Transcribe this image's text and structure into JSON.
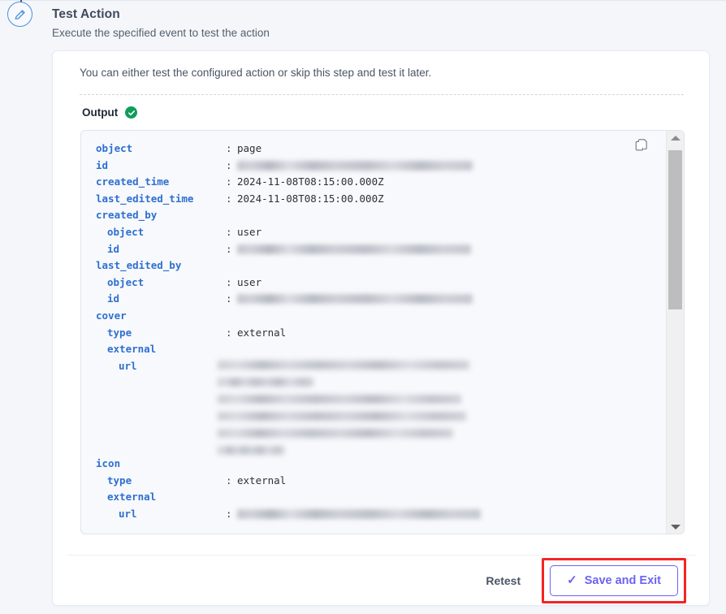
{
  "step": {
    "icon": "pencil-circle-icon",
    "accent_color": "#4a90e2"
  },
  "header": {
    "title": "Test Action",
    "subtitle": "Execute the specified event to test the action"
  },
  "card": {
    "intro": "You can either test the configured action or skip this step and test it later.",
    "output": {
      "label": "Output",
      "status_icon": "success-check-icon",
      "status_color": "#0f9d58",
      "copy_icon": "copy-icon",
      "rows": [
        {
          "depth": 1,
          "key": "object",
          "colon": ":",
          "value": "page"
        },
        {
          "depth": 1,
          "key": "id",
          "colon": ":",
          "value": "",
          "redacted": true,
          "redact_width": 290
        },
        {
          "depth": 1,
          "key": "created_time",
          "colon": ":",
          "value": "2024-11-08T08:15:00.000Z"
        },
        {
          "depth": 1,
          "key": "last_edited_time",
          "colon": ":",
          "value": "2024-11-08T08:15:00.000Z"
        },
        {
          "depth": 1,
          "key": "created_by",
          "colon": "",
          "value": ""
        },
        {
          "depth": 2,
          "key": "object",
          "colon": ":",
          "value": "user"
        },
        {
          "depth": 2,
          "key": "id",
          "colon": ":",
          "value": "",
          "redacted": true,
          "redact_width": 288
        },
        {
          "depth": 1,
          "key": "last_edited_by",
          "colon": "",
          "value": ""
        },
        {
          "depth": 2,
          "key": "object",
          "colon": ":",
          "value": "user"
        },
        {
          "depth": 2,
          "key": "id",
          "colon": ":",
          "value": "",
          "redacted": true,
          "redact_width": 290
        },
        {
          "depth": 1,
          "key": "cover",
          "colon": "",
          "value": ""
        },
        {
          "depth": 2,
          "key": "type",
          "colon": ":",
          "value": "external"
        },
        {
          "depth": 2,
          "key": "external",
          "colon": "",
          "value": ""
        },
        {
          "depth": 3,
          "key": "url",
          "colon": "",
          "value": "",
          "redacted_block": true
        }
      ],
      "rows2": [
        {
          "depth": 1,
          "key": "icon",
          "colon": "",
          "value": ""
        },
        {
          "depth": 2,
          "key": "type",
          "colon": ":",
          "value": "external"
        },
        {
          "depth": 2,
          "key": "external",
          "colon": "",
          "value": ""
        },
        {
          "depth": 3,
          "key": "url",
          "colon": ":",
          "value": "",
          "redacted": true,
          "redact_width": 300
        }
      ],
      "scrollbar": {
        "up_arrow": "scroll-up-arrow-icon",
        "down_arrow": "scroll-down-arrow-icon"
      }
    }
  },
  "footer": {
    "retest_label": "Retest",
    "save_label": "Save and Exit",
    "save_icon": "check-icon",
    "save_accent": "#6c63f0",
    "highlight_color": "#f42424"
  }
}
